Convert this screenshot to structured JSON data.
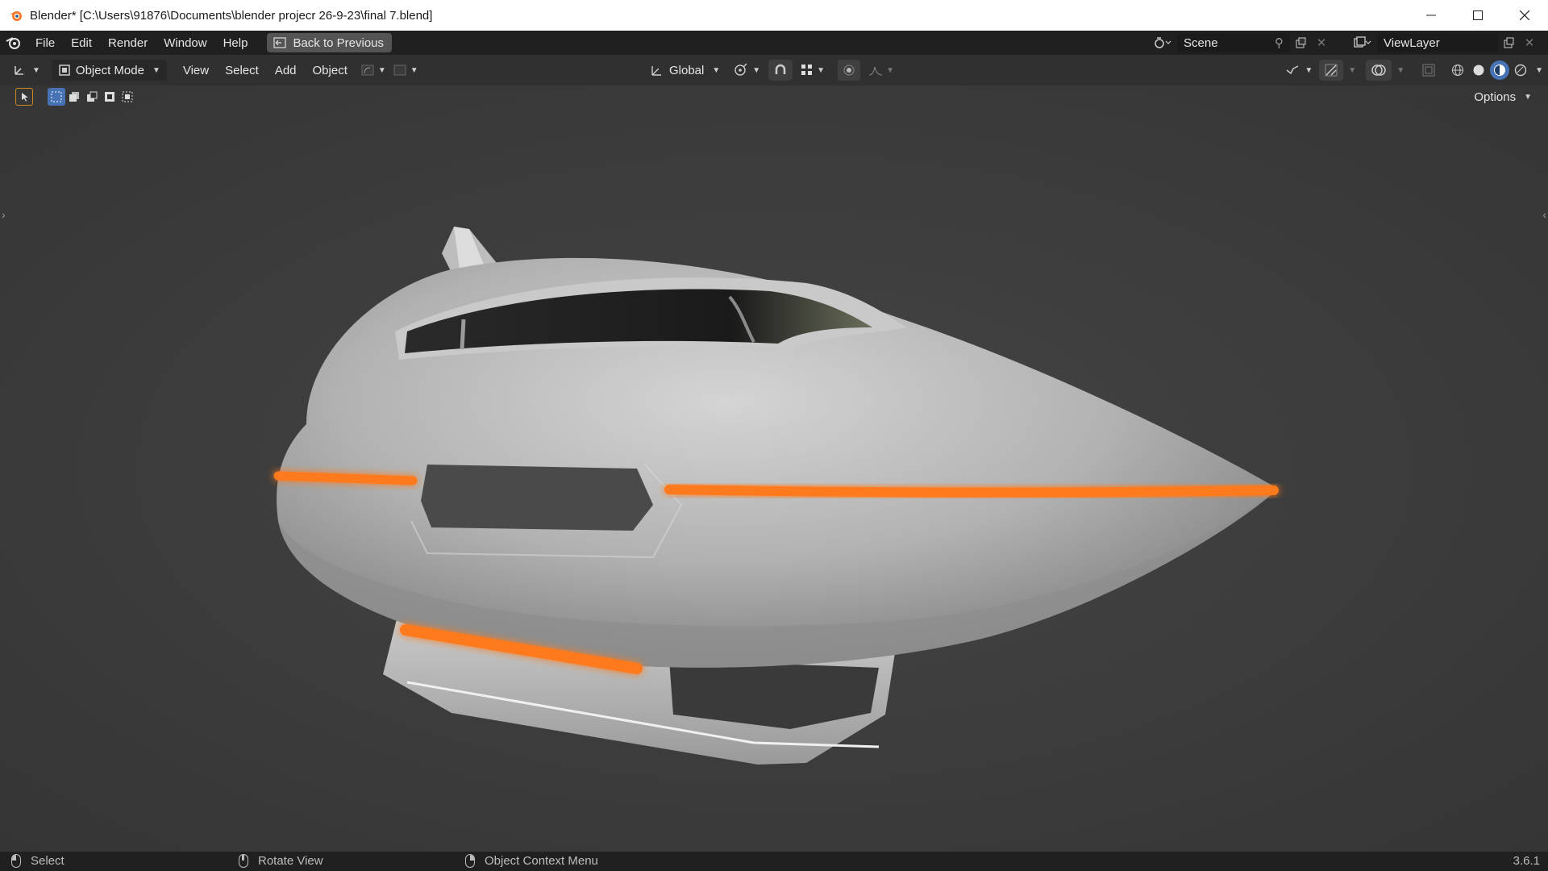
{
  "window": {
    "title": "Blender* [C:\\Users\\91876\\Documents\\blender projecr 26-9-23\\final 7.blend]",
    "controls": [
      "minimize-icon",
      "maximize-icon",
      "close-icon"
    ]
  },
  "menubar": {
    "items": [
      "File",
      "Edit",
      "Render",
      "Window",
      "Help"
    ],
    "back_button": "Back to Previous",
    "scene": "Scene",
    "view_layer": "ViewLayer"
  },
  "viewport_header": {
    "mode": "Object Mode",
    "menus": [
      "View",
      "Select",
      "Add",
      "Object"
    ],
    "transform_orientation": "Global",
    "options": "Options",
    "active_shading": "material-preview"
  },
  "statusbar": {
    "select": "Select",
    "rotate": "Rotate View",
    "context": "Object Context Menu",
    "version": "3.6.1"
  },
  "colors": {
    "accent": "#4772b3",
    "glow": "#ff7a1a",
    "hull": "#b9b9b9",
    "background": "#3d3d3d"
  }
}
